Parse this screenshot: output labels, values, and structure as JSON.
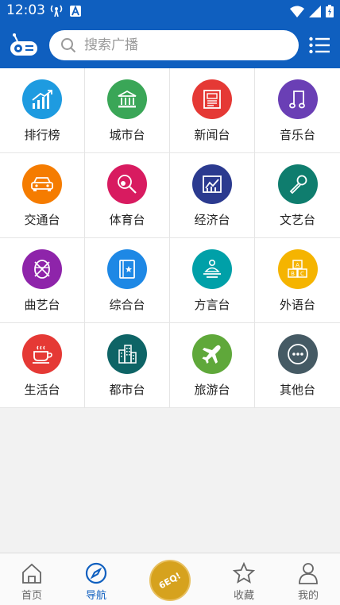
{
  "status": {
    "time": "12:03"
  },
  "search": {
    "placeholder": "搜索广播"
  },
  "categories": [
    {
      "label": "排行榜",
      "color": "#1e9be0",
      "icon": "trending-chart-icon"
    },
    {
      "label": "城市台",
      "color": "#3aa657",
      "icon": "building-columns-icon"
    },
    {
      "label": "新闻台",
      "color": "#e53935",
      "icon": "newspaper-icon"
    },
    {
      "label": "音乐台",
      "color": "#6a3fb5",
      "icon": "music-note-icon"
    },
    {
      "label": "交通台",
      "color": "#f57c00",
      "icon": "car-icon"
    },
    {
      "label": "体育台",
      "color": "#d81b60",
      "icon": "sports-racket-icon"
    },
    {
      "label": "经济台",
      "color": "#2b3a8f",
      "icon": "line-chart-icon"
    },
    {
      "label": "文艺台",
      "color": "#0f7d6e",
      "icon": "microphone-icon"
    },
    {
      "label": "曲艺台",
      "color": "#8e24aa",
      "icon": "drum-icon"
    },
    {
      "label": "综合台",
      "color": "#1e88e5",
      "icon": "book-star-icon"
    },
    {
      "label": "方言台",
      "color": "#00a0a8",
      "icon": "speaker-person-icon"
    },
    {
      "label": "外语台",
      "color": "#f5b400",
      "icon": "abc-blocks-icon"
    },
    {
      "label": "生活台",
      "color": "#e53935",
      "icon": "coffee-cup-icon"
    },
    {
      "label": "都市台",
      "color": "#0e6466",
      "icon": "city-buildings-icon"
    },
    {
      "label": "旅游台",
      "color": "#5fa83a",
      "icon": "airplane-icon"
    },
    {
      "label": "其他台",
      "color": "#455a64",
      "icon": "more-dots-icon"
    }
  ],
  "nav": {
    "home": "首页",
    "navigate": "导航",
    "center_logo_text": "6EQ!",
    "favorites": "收藏",
    "mine": "我的"
  },
  "colors": {
    "primary": "#0f5fbf",
    "center_button": "#d6a21e"
  }
}
